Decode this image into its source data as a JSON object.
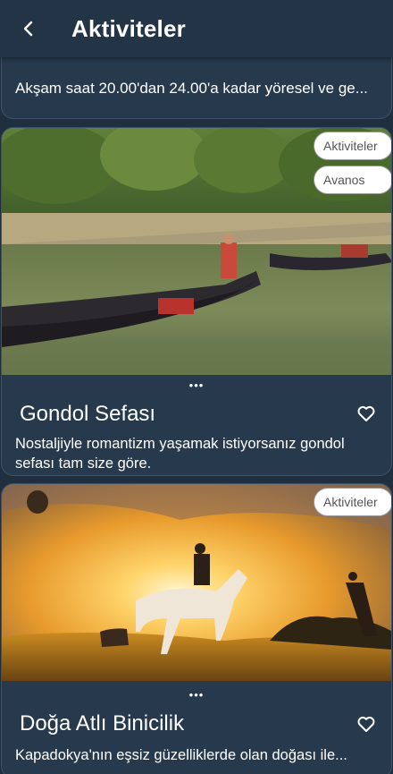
{
  "header": {
    "title": "Aktiviteler",
    "back_icon": "chevron-left-icon"
  },
  "top_card": {
    "description": "Akşam saat 20.00'dan 24.00'a kadar yöresel ve ge..."
  },
  "cards": [
    {
      "title": "Gondol Sefası",
      "description": "Nostaljiyle romantizm yaşamak istiyorsanız gondol sefası tam size göre.",
      "chips": [
        "Aktiviteler",
        "Avanos"
      ],
      "image": "gondola-river-image",
      "dots": "•••"
    },
    {
      "title": "Doğa Atlı Binicilik",
      "description": "Kapadokya'nın eşsiz güzelliklerde olan doğası ile...",
      "chips": [
        "Aktiviteler"
      ],
      "image": "horse-riding-sunset-image",
      "dots": "•••"
    }
  ],
  "colors": {
    "background": "#1f2f40",
    "card": "#27394d",
    "topbar": "#233447"
  }
}
